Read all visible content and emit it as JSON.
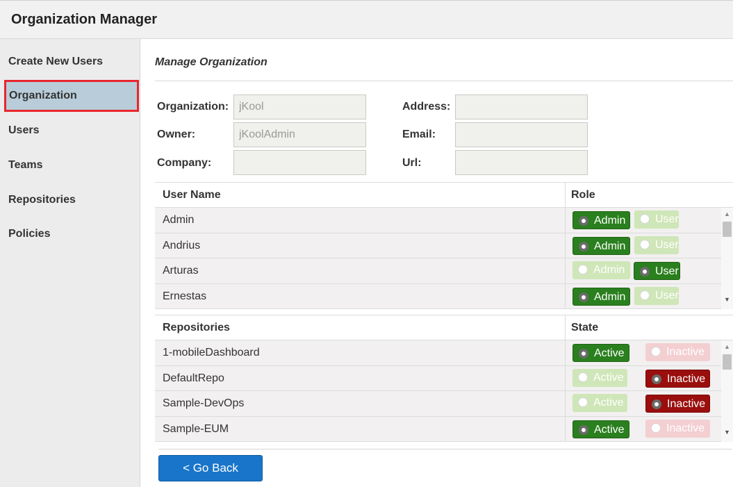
{
  "app": {
    "title": "Organization Manager"
  },
  "sidebar": {
    "items": [
      {
        "label": "Create New Users"
      },
      {
        "label": "Organization"
      },
      {
        "label": "Users"
      },
      {
        "label": "Teams"
      },
      {
        "label": "Repositories"
      },
      {
        "label": "Policies"
      }
    ],
    "selected": "Organization",
    "highlight_color": "#e8262c"
  },
  "main": {
    "section_title": "Manage Organization",
    "fields": {
      "organization": {
        "label": "Organization:",
        "value": "jKool"
      },
      "owner": {
        "label": "Owner:",
        "value": "jKoolAdmin"
      },
      "company": {
        "label": "Company:",
        "value": ""
      },
      "address": {
        "label": "Address:",
        "value": ""
      },
      "email": {
        "label": "Email:",
        "value": ""
      },
      "url": {
        "label": "Url:",
        "value": ""
      }
    },
    "users_table": {
      "headers": [
        "User Name",
        "Role"
      ],
      "rows": [
        {
          "name": "Admin",
          "role": "Admin"
        },
        {
          "name": "Andrius",
          "role": "Admin"
        },
        {
          "name": "Arturas",
          "role": "User"
        },
        {
          "name": "Ernestas",
          "role": "Admin"
        }
      ],
      "role_options": [
        "Admin",
        "User"
      ]
    },
    "repos_table": {
      "headers": [
        "Repositories",
        "State"
      ],
      "rows": [
        {
          "name": "1-mobileDashboard",
          "state": "Active"
        },
        {
          "name": "DefaultRepo",
          "state": "Inactive"
        },
        {
          "name": "Sample-DevOps",
          "state": "Inactive"
        },
        {
          "name": "Sample-EUM",
          "state": "Active"
        }
      ],
      "state_options": [
        "Active",
        "Inactive"
      ]
    },
    "go_back_label": "< Go Back"
  },
  "colors": {
    "active_green": "#2a7f1e",
    "inactive_red": "#9a0e0e",
    "button_blue": "#1975c9"
  }
}
